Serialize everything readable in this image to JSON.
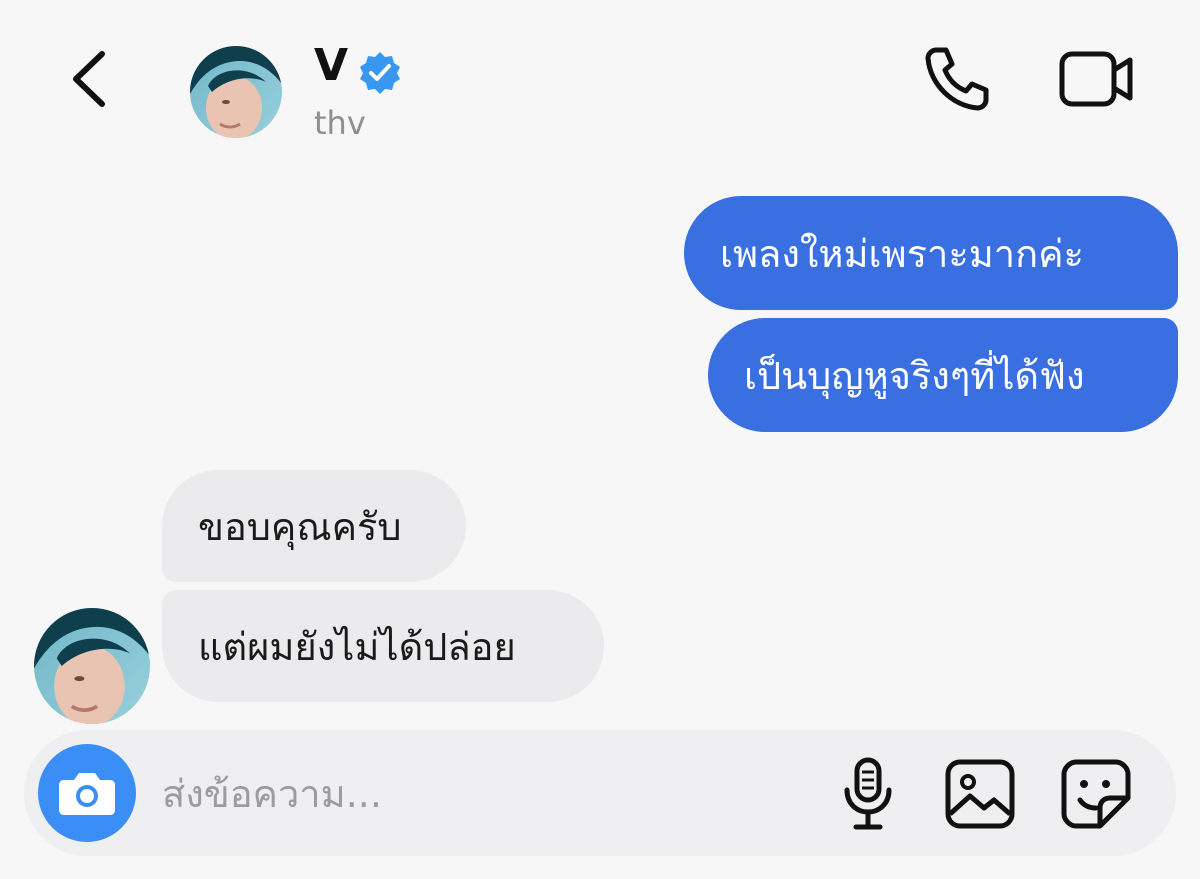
{
  "header": {
    "name": "V",
    "username": "thv",
    "verified": true,
    "icons": {
      "back": "chevron-left-icon",
      "verified": "verified-badge-icon",
      "call": "phone-icon",
      "video": "video-camera-icon"
    }
  },
  "messages": [
    {
      "direction": "outgoing",
      "text": "เพลงใหม่เพราะมากค่ะ"
    },
    {
      "direction": "outgoing",
      "text": "เป็นบุญหูจริงๆที่ได้ฟัง"
    },
    {
      "direction": "incoming",
      "text": "ขอบคุณครับ"
    },
    {
      "direction": "incoming",
      "text": "แต่ผมยังไม่ได้ปล่อย"
    }
  ],
  "composer": {
    "placeholder": "ส่งข้อความ...",
    "value": "",
    "icons": {
      "camera": "camera-icon",
      "mic": "microphone-icon",
      "gallery": "image-icon",
      "sticker": "sticker-icon"
    }
  },
  "colors": {
    "outgoing_bubble": "#3a6fe1",
    "incoming_bubble": "#ebebed",
    "verified_badge": "#3897f0",
    "camera_button": "#3a8ef6",
    "background": "#f7f7f8"
  }
}
